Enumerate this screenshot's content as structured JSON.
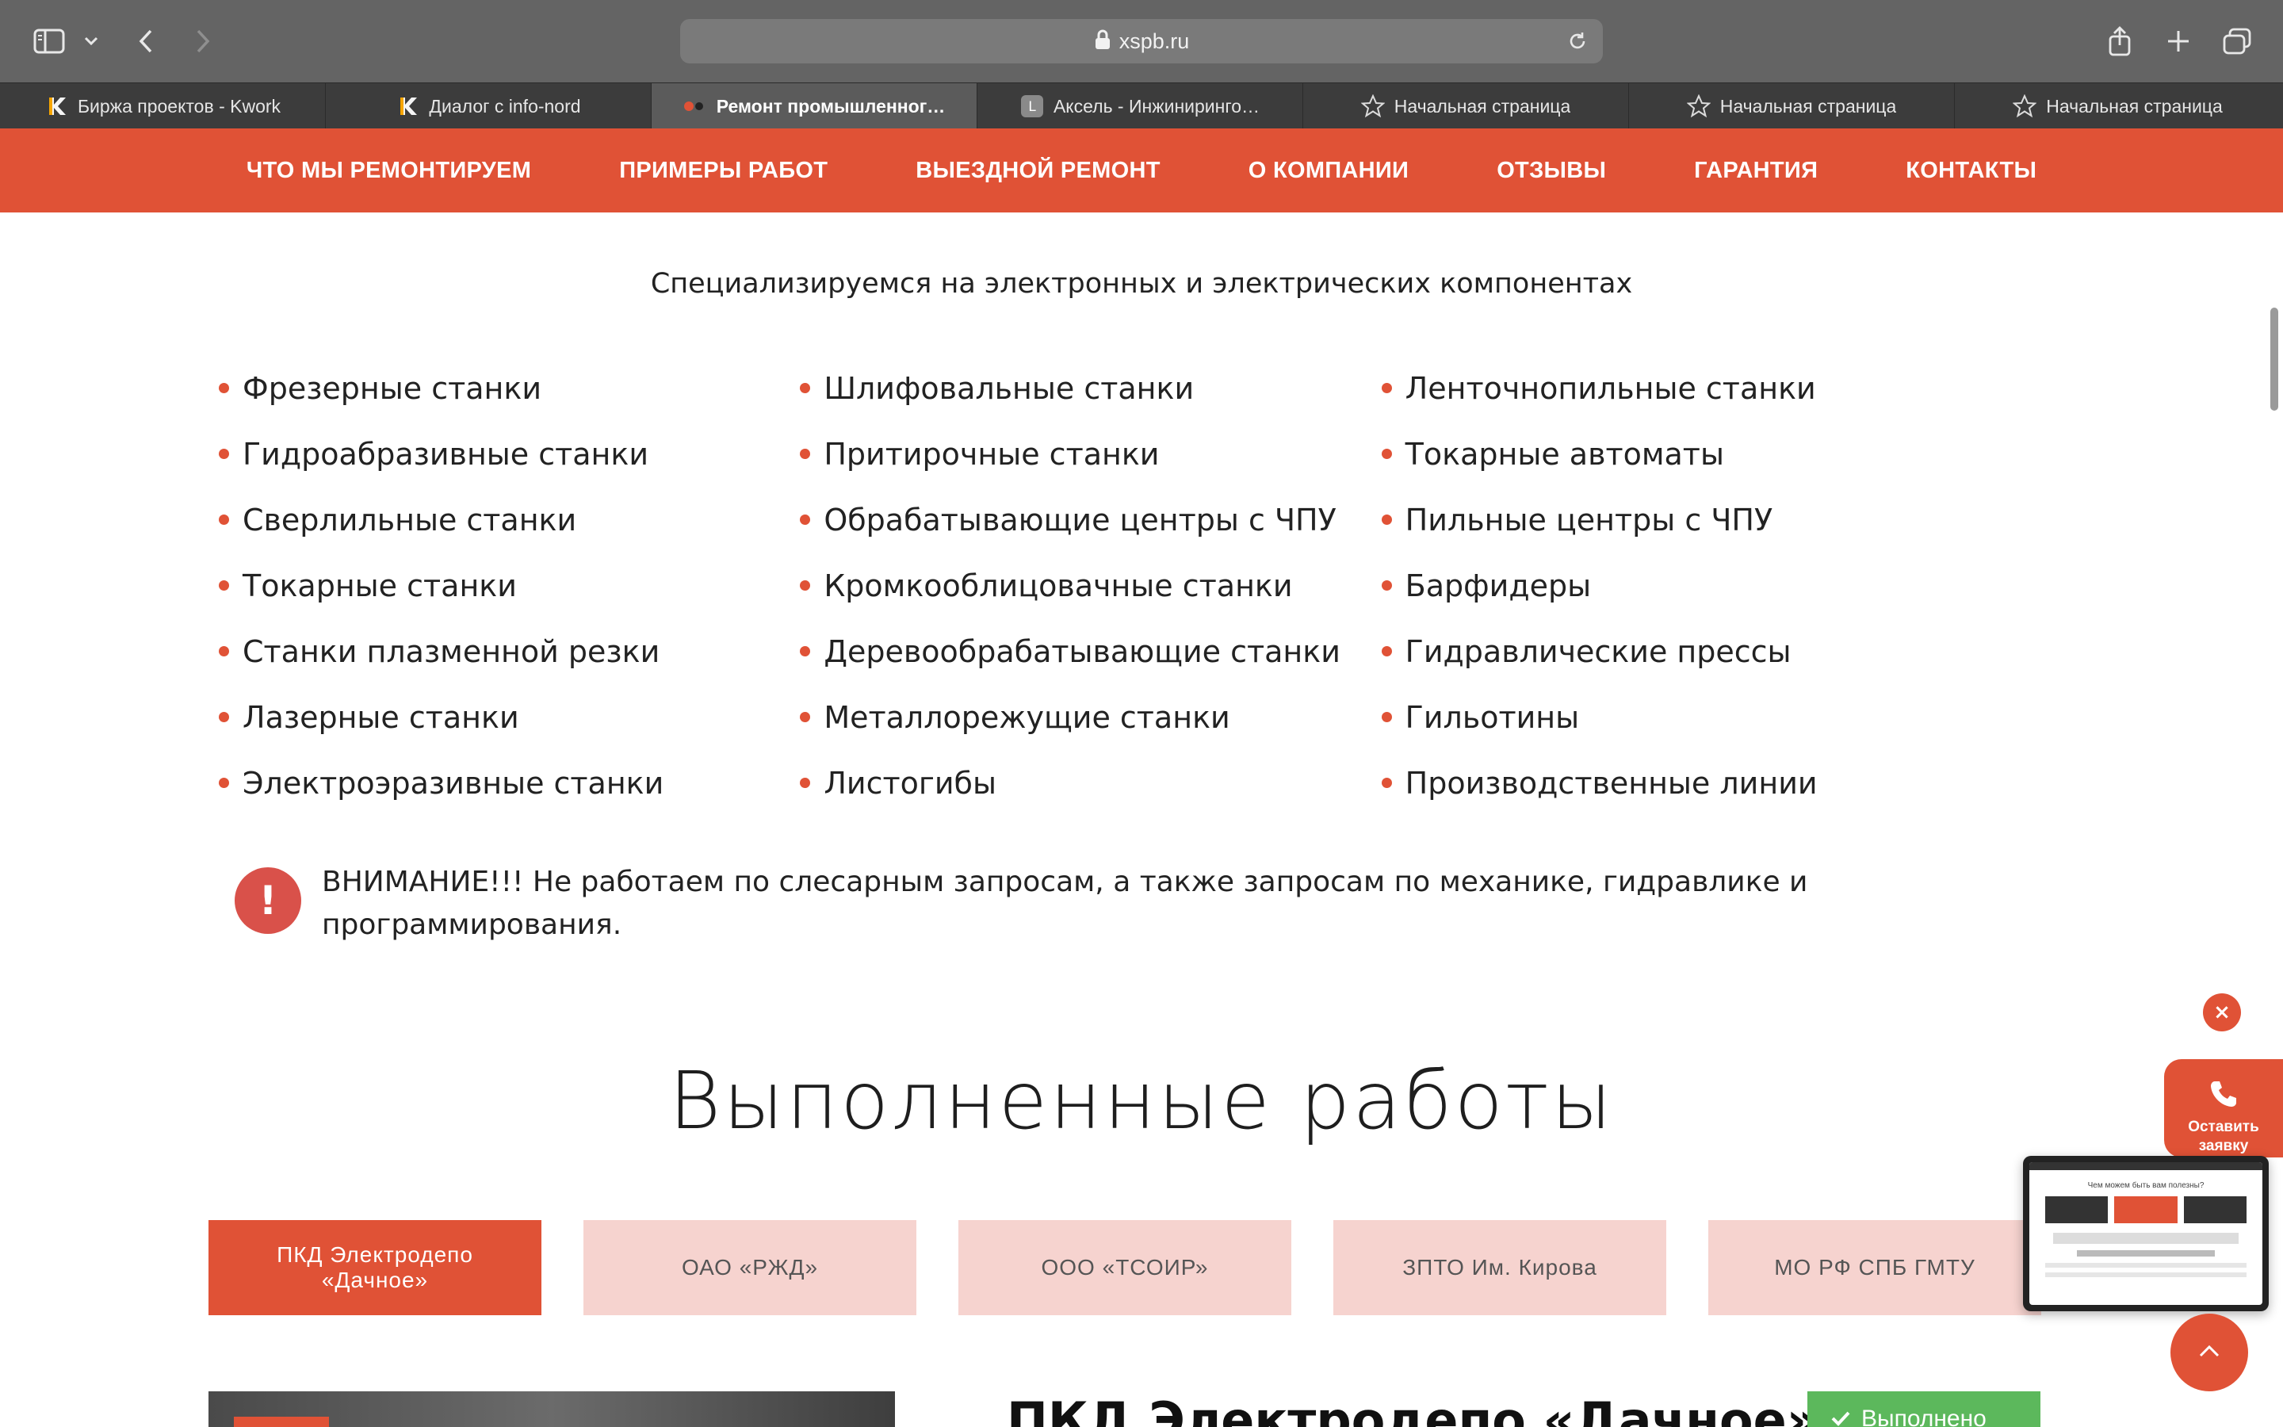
{
  "browser": {
    "url": "xspb.ru",
    "tabs": [
      {
        "label": "Биржа проектов - Kwork",
        "icon": "kwork-icon",
        "active": false
      },
      {
        "label": "Диалог с info-nord",
        "icon": "kwork-icon",
        "active": false
      },
      {
        "label": "Ремонт промышленног…",
        "icon": "site-favicon",
        "active": true
      },
      {
        "label": "Аксель - Инжиниринго…",
        "icon": "letter-l-icon",
        "active": false
      },
      {
        "label": "Начальная страница",
        "icon": "star-icon",
        "active": false
      },
      {
        "label": "Начальная страница",
        "icon": "star-icon",
        "active": false
      },
      {
        "label": "Начальная страница",
        "icon": "star-icon",
        "active": false
      }
    ],
    "tab_fav_letters": {
      "letter_l": "L"
    }
  },
  "nav": {
    "items": [
      "ЧТО МЫ РЕМОНТИРУЕМ",
      "ПРИМЕРЫ РАБОТ",
      "ВЫЕЗДНОЙ РЕМОНТ",
      "О КОМПАНИИ",
      "ОТЗЫВЫ",
      "ГАРАНТИЯ",
      "КОНТАКТЫ"
    ]
  },
  "content": {
    "subtitle": "Специализируемся на электронных и электрических компонентах",
    "machines": {
      "col1": [
        "Фрезерные станки",
        "Гидроабразивные станки",
        "Сверлильные станки",
        "Токарные станки",
        "Станки плазменной резки",
        "Лазерные станки",
        "Электроэразивные станки"
      ],
      "col2": [
        "Шлифовальные станки",
        "Притирочные станки",
        "Обрабатывающие центры с ЧПУ",
        "Кромкооблицовачные станки",
        "Деревообрабатывающие станки",
        "Металлорежущие станки",
        "Листогибы"
      ],
      "col3": [
        "Ленточнопильные станки",
        "Токарные автоматы",
        "Пильные центры с ЧПУ",
        "Барфидеры",
        "Гидравлические прессы",
        "Гильотины",
        "Производственные линии"
      ]
    },
    "warning": {
      "icon_text": "!",
      "text": "ВНИМАНИЕ!!! Не работаем по слесарным запросам, а также запросам по механике, гидравлике и программирования."
    },
    "works_title": "Выполненные работы",
    "works_tabs": [
      {
        "label": "ПКД Электродепо «Дачное»",
        "active": true
      },
      {
        "label": "ОАО «РЖД»",
        "active": false
      },
      {
        "label": "ООО «ТСОИР»",
        "active": false
      },
      {
        "label": "ЗПТО Им. Кирова",
        "active": false
      },
      {
        "label": "МО РФ СПБ ГМТУ",
        "active": false
      }
    ],
    "work_title": "ПКД Электродепо «Дачное»",
    "status_badge": "Выполнено"
  },
  "widgets": {
    "close_glyph": "×",
    "callback_label": "Оставить\nзаявку",
    "preview_heading": "Чем можем быть вам полезны?"
  },
  "colors": {
    "accent": "#e05236",
    "tab_inactive_bg": "#f6d3cf",
    "success": "#5cb85c"
  }
}
